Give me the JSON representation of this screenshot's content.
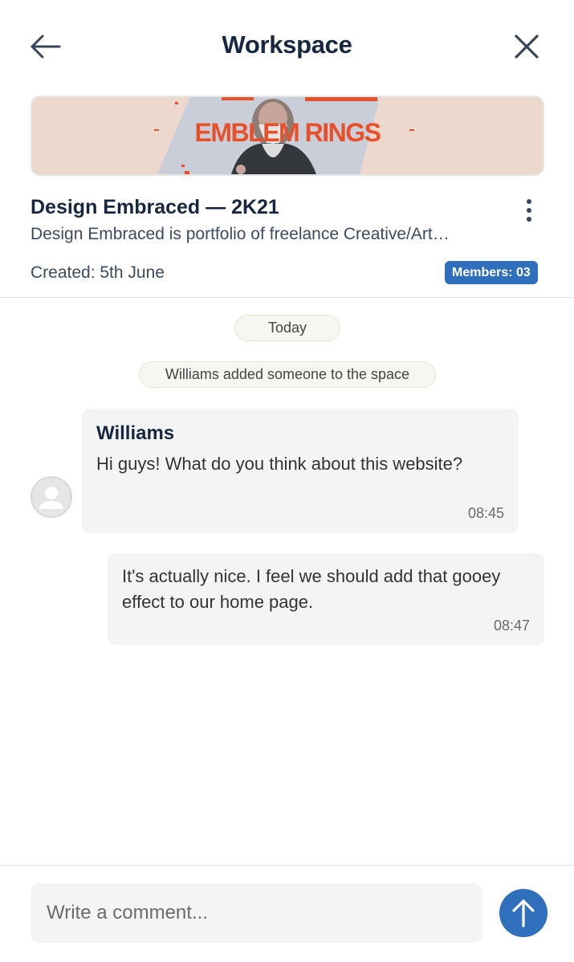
{
  "header": {
    "title": "Workspace",
    "back_icon": "arrow-left-icon",
    "close_icon": "close-icon"
  },
  "workspace": {
    "banner_text": "EMBLEM RINGS",
    "name": "Design Embraced — 2K21",
    "description": "Design Embraced is portfolio of freelance Creative/Art…",
    "created": "Created: 5th June",
    "members_badge": "Members: 03",
    "more_icon": "more-vertical-icon"
  },
  "chat": {
    "date_pill": "Today",
    "event_pill": "Williams added someone to the space",
    "messages": [
      {
        "sender": "Williams",
        "text": "Hi guys! What do you think about this website?",
        "time": "08:45",
        "avatar_icon": "user-avatar-icon"
      },
      {
        "text": "It's actually nice. I feel we should add that gooey effect to our home page.",
        "time": "08:47"
      }
    ]
  },
  "composer": {
    "placeholder": "Write a comment...",
    "send_icon": "arrow-up-icon"
  },
  "colors": {
    "accent": "#2f6fbb",
    "title_text": "#16273f",
    "banner_bg": "#ecd8cc",
    "banner_text": "#e8502a",
    "bubble_bg": "#f4f4f4"
  }
}
